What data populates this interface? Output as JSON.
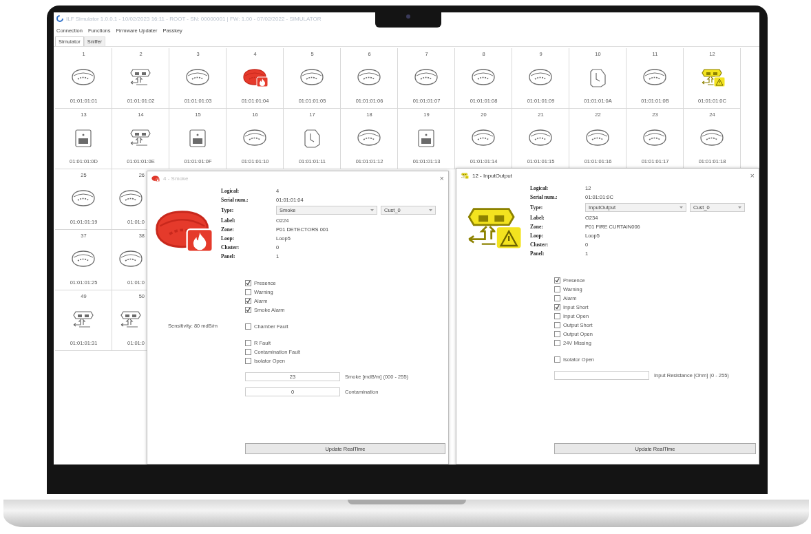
{
  "window": {
    "title": "ILF Simulator 1.0.0.1 - 10/02/2023 16:11 - ROOT - SN: 00000001 | FW: 1.00 - 07/02/2022 - SIMULATOR"
  },
  "menu": [
    "Connection",
    "Functions",
    "Firmware Updater",
    "Passkey"
  ],
  "tabs": [
    {
      "label": "Simulator",
      "selected": true
    },
    {
      "label": "Sniffer",
      "selected": false
    }
  ],
  "grid": {
    "rows": [
      [
        {
          "number": "1",
          "serial": "01:01:01:01",
          "kind": "smoke",
          "alarm": false,
          "fault": false
        },
        {
          "number": "2",
          "serial": "01:01:01:02",
          "kind": "io",
          "alarm": false,
          "fault": false
        },
        {
          "number": "3",
          "serial": "01:01:01:03",
          "kind": "smoke",
          "alarm": false,
          "fault": false
        },
        {
          "number": "4",
          "serial": "01:01:01:04",
          "kind": "smoke",
          "alarm": true,
          "fault": false
        },
        {
          "number": "5",
          "serial": "01:01:01:05",
          "kind": "smoke",
          "alarm": false,
          "fault": false
        },
        {
          "number": "6",
          "serial": "01:01:01:06",
          "kind": "smoke",
          "alarm": false,
          "fault": false
        },
        {
          "number": "7",
          "serial": "01:01:01:07",
          "kind": "smoke",
          "alarm": false,
          "fault": false
        },
        {
          "number": "8",
          "serial": "01:01:01:08",
          "kind": "smoke",
          "alarm": false,
          "fault": false
        },
        {
          "number": "9",
          "serial": "01:01:01:09",
          "kind": "smoke",
          "alarm": false,
          "fault": false
        },
        {
          "number": "10",
          "serial": "01:01:01:0A",
          "kind": "wall",
          "alarm": false,
          "fault": false
        },
        {
          "number": "11",
          "serial": "01:01:01:0B",
          "kind": "smoke",
          "alarm": false,
          "fault": false
        },
        {
          "number": "12",
          "serial": "01:01:01:0C",
          "kind": "io",
          "alarm": false,
          "fault": true
        }
      ],
      [
        {
          "number": "13",
          "serial": "01:01:01:0D",
          "kind": "box",
          "alarm": false,
          "fault": false
        },
        {
          "number": "14",
          "serial": "01:01:01:0E",
          "kind": "io",
          "alarm": false,
          "fault": false
        },
        {
          "number": "15",
          "serial": "01:01:01:0F",
          "kind": "box",
          "alarm": false,
          "fault": false
        },
        {
          "number": "16",
          "serial": "01:01:01:10",
          "kind": "smoke",
          "alarm": false,
          "fault": false
        },
        {
          "number": "17",
          "serial": "01:01:01:11",
          "kind": "wall",
          "alarm": false,
          "fault": false
        },
        {
          "number": "18",
          "serial": "01:01:01:12",
          "kind": "smoke",
          "alarm": false,
          "fault": false
        },
        {
          "number": "19",
          "serial": "01:01:01:13",
          "kind": "box",
          "alarm": false,
          "fault": false
        },
        {
          "number": "20",
          "serial": "01:01:01:14",
          "kind": "smoke",
          "alarm": false,
          "fault": false
        },
        {
          "number": "21",
          "serial": "01:01:01:15",
          "kind": "smoke",
          "alarm": false,
          "fault": false
        },
        {
          "number": "22",
          "serial": "01:01:01:16",
          "kind": "smoke",
          "alarm": false,
          "fault": false
        },
        {
          "number": "23",
          "serial": "01:01:01:17",
          "kind": "smoke",
          "alarm": false,
          "fault": false
        },
        {
          "number": "24",
          "serial": "01:01:01:18",
          "kind": "smoke",
          "alarm": false,
          "fault": false
        }
      ],
      [
        {
          "number": "25",
          "serial": "01:01:01:19",
          "kind": "smoke",
          "alarm": false,
          "fault": false
        },
        {
          "number": "26",
          "serial": "01:01:0",
          "kind": "smoke",
          "alarm": false,
          "fault": false,
          "partial": true
        }
      ],
      [
        {
          "number": "37",
          "serial": "01:01:01:25",
          "kind": "smoke",
          "alarm": false,
          "fault": false
        },
        {
          "number": "38",
          "serial": "01:01:0",
          "kind": "smoke",
          "alarm": false,
          "fault": false,
          "partial": true
        }
      ],
      [
        {
          "number": "49",
          "serial": "01:01:01:31",
          "kind": "io",
          "alarm": false,
          "fault": false
        },
        {
          "number": "50",
          "serial": "01:01:0",
          "kind": "io",
          "alarm": false,
          "fault": false,
          "partial": true
        }
      ]
    ]
  },
  "dialogs": [
    {
      "title": "4 - Smoke",
      "close": "×",
      "kind": "smoke",
      "alarm": true,
      "fault": false,
      "fields": [
        {
          "kind": "text",
          "label": "Logical:",
          "value": "4"
        },
        {
          "kind": "text",
          "label": "Serial num.:",
          "value": "01:01:01:04"
        },
        {
          "kind": "dropdowns",
          "label": "Type:",
          "values": [
            "Smoke",
            "Cust_0"
          ]
        },
        {
          "kind": "text",
          "label": "Label:",
          "value": "O224"
        },
        {
          "kind": "text",
          "label": "Zone:",
          "value": "P01 DETECTORS 001"
        },
        {
          "kind": "text",
          "label": "Loop:",
          "value": "Loop5"
        },
        {
          "kind": "text",
          "label": "Cluster:",
          "value": "0"
        },
        {
          "kind": "text",
          "label": "Panel:",
          "value": "1"
        }
      ],
      "sensitivity": "Sensitivity: 80 mdB/m",
      "checkbox_groups": [
        [
          {
            "label": "Presence",
            "checked": true
          },
          {
            "label": "Warning",
            "checked": false
          },
          {
            "label": "Alarm",
            "checked": true
          },
          {
            "label": "Smoke Alarm",
            "checked": true
          }
        ],
        [
          {
            "label": "Chamber Fault",
            "checked": false
          }
        ],
        [
          {
            "label": "R Fault",
            "checked": false
          },
          {
            "label": "Contamination Fault",
            "checked": false
          },
          {
            "label": "Isolator Open",
            "checked": false
          }
        ]
      ],
      "inputs": [
        {
          "value": "23",
          "label": "Smoke [mdB/m] (000 - 255)"
        },
        {
          "value": "0",
          "label": "Contamination"
        }
      ],
      "button": "Update RealTime"
    },
    {
      "title": "12 - InputOutput",
      "close": "×",
      "kind": "io",
      "alarm": false,
      "fault": true,
      "fields": [
        {
          "kind": "text",
          "label": "Logical:",
          "value": "12"
        },
        {
          "kind": "text",
          "label": "Serial num.:",
          "value": "01:01:01:0C"
        },
        {
          "kind": "dropdowns",
          "label": "Type:",
          "values": [
            "InputOutput",
            "Cust_0"
          ]
        },
        {
          "kind": "text",
          "label": "Label:",
          "value": "O234"
        },
        {
          "kind": "text",
          "label": "Zone:",
          "value": "P01 FIRE CURTAIN006"
        },
        {
          "kind": "text",
          "label": "Loop:",
          "value": "Loop5"
        },
        {
          "kind": "text",
          "label": "Cluster:",
          "value": "0"
        },
        {
          "kind": "text",
          "label": "Panel:",
          "value": "1"
        }
      ],
      "checkbox_groups": [
        [
          {
            "label": "Presence",
            "checked": true
          },
          {
            "label": "Warning",
            "checked": false
          },
          {
            "label": "Alarm",
            "checked": false
          },
          {
            "label": "Input Short",
            "checked": true
          },
          {
            "label": "Input Open",
            "checked": false
          },
          {
            "label": "Output Short",
            "checked": false
          },
          {
            "label": "Output Open",
            "checked": false
          },
          {
            "label": "24V Missing",
            "checked": false
          }
        ],
        [
          {
            "label": "Isolator Open",
            "checked": false
          }
        ]
      ],
      "inputs": [
        {
          "label": "Input Resistance [Ohm] (0 - 255)"
        }
      ],
      "button": "Update RealTime"
    }
  ]
}
